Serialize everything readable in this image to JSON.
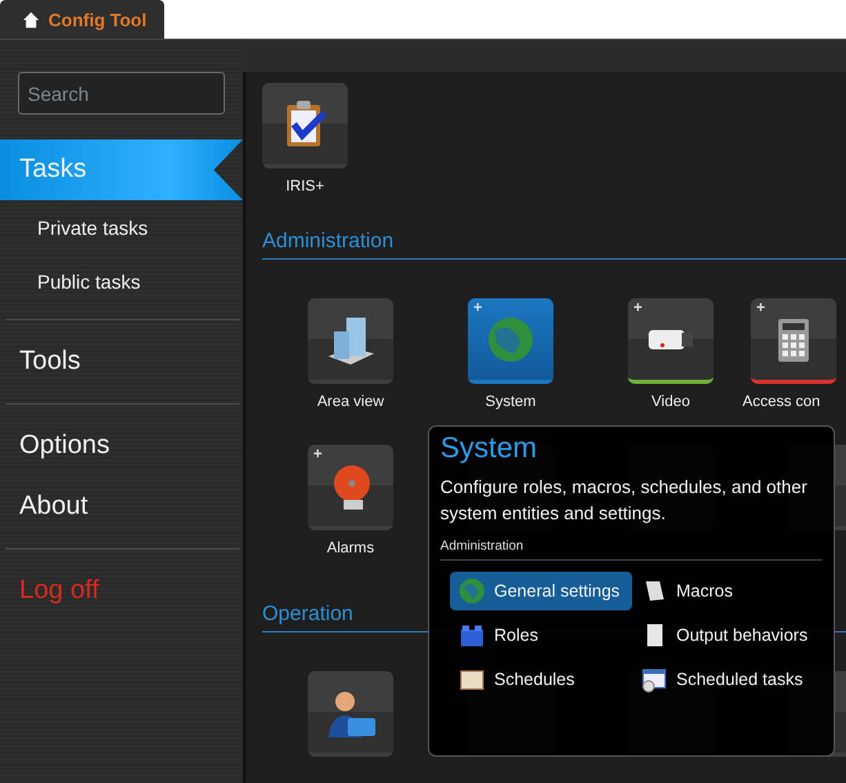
{
  "tab": {
    "title": "Config Tool"
  },
  "search": {
    "placeholder": "Search"
  },
  "sidebar": {
    "groups": [
      {
        "items": [
          {
            "label": "Tasks",
            "kind": "section",
            "selected": true
          },
          {
            "label": "Private tasks",
            "kind": "sub",
            "selected": false
          },
          {
            "label": "Public tasks",
            "kind": "sub",
            "selected": false
          }
        ]
      },
      {
        "items": [
          {
            "label": "Tools",
            "kind": "section",
            "selected": false
          }
        ]
      },
      {
        "items": [
          {
            "label": "Options",
            "kind": "section",
            "selected": false
          },
          {
            "label": "About",
            "kind": "section",
            "selected": false
          }
        ]
      },
      {
        "items": [
          {
            "label": "Log off",
            "kind": "logoff",
            "selected": false
          }
        ]
      }
    ]
  },
  "sections": [
    {
      "tiles": [
        {
          "kind": "app",
          "label": "IRIS+",
          "selected": false
        }
      ]
    },
    {
      "title": "Administration",
      "tiles": [
        {
          "kind": "app",
          "label": "Area view",
          "selected": false
        },
        {
          "kind": "app",
          "label": "System",
          "selected": true,
          "badge": "+"
        },
        {
          "kind": "app",
          "label": "Video",
          "selected": false,
          "badge": "+",
          "color": "#6fb33a"
        },
        {
          "kind": "app",
          "label": "Access con",
          "selected": false,
          "badge": "+",
          "color": "#d9312b"
        },
        {
          "kind": "app",
          "label": "Alarms",
          "selected": false,
          "badge": "+"
        },
        {
          "kind": "hidden"
        },
        {
          "kind": "hidden"
        },
        {
          "kind": "hidden"
        }
      ]
    },
    {
      "title": "Operation",
      "tiles": [
        {
          "kind": "app",
          "selected": false
        },
        {
          "kind": "hidden"
        },
        {
          "kind": "hidden"
        },
        {
          "kind": "hidden"
        }
      ]
    }
  ],
  "popup": {
    "title": "System",
    "description": "Configure roles, macros, schedules, and other system entities and settings.",
    "group": "Administration",
    "items": [
      {
        "label": "General settings",
        "selected": true
      },
      {
        "label": "Macros",
        "selected": false
      },
      {
        "label": "Roles",
        "selected": false
      },
      {
        "label": "Output behaviors",
        "selected": false
      },
      {
        "label": "Schedules",
        "selected": false
      },
      {
        "label": "Scheduled tasks",
        "selected": false
      }
    ]
  }
}
